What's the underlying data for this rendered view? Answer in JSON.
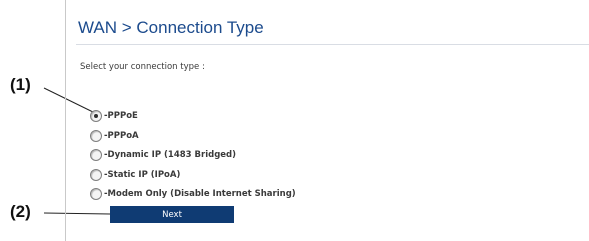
{
  "callouts": [
    "(1)",
    "(2)"
  ],
  "page": {
    "title": "WAN > Connection Type",
    "prompt": "Select your connection type :"
  },
  "options": [
    {
      "label": "-PPPoE",
      "checked": true
    },
    {
      "label": "-PPPoA",
      "checked": false
    },
    {
      "label": "-Dynamic IP (1483 Bridged)",
      "checked": false
    },
    {
      "label": "-Static IP (IPoA)",
      "checked": false
    },
    {
      "label": "-Modem Only (Disable Internet Sharing)",
      "checked": false
    }
  ],
  "buttons": {
    "next": "Next"
  },
  "colors": {
    "title": "#1c4b8d",
    "button_bg": "#0f3b73",
    "button_text": "#ffffff"
  }
}
